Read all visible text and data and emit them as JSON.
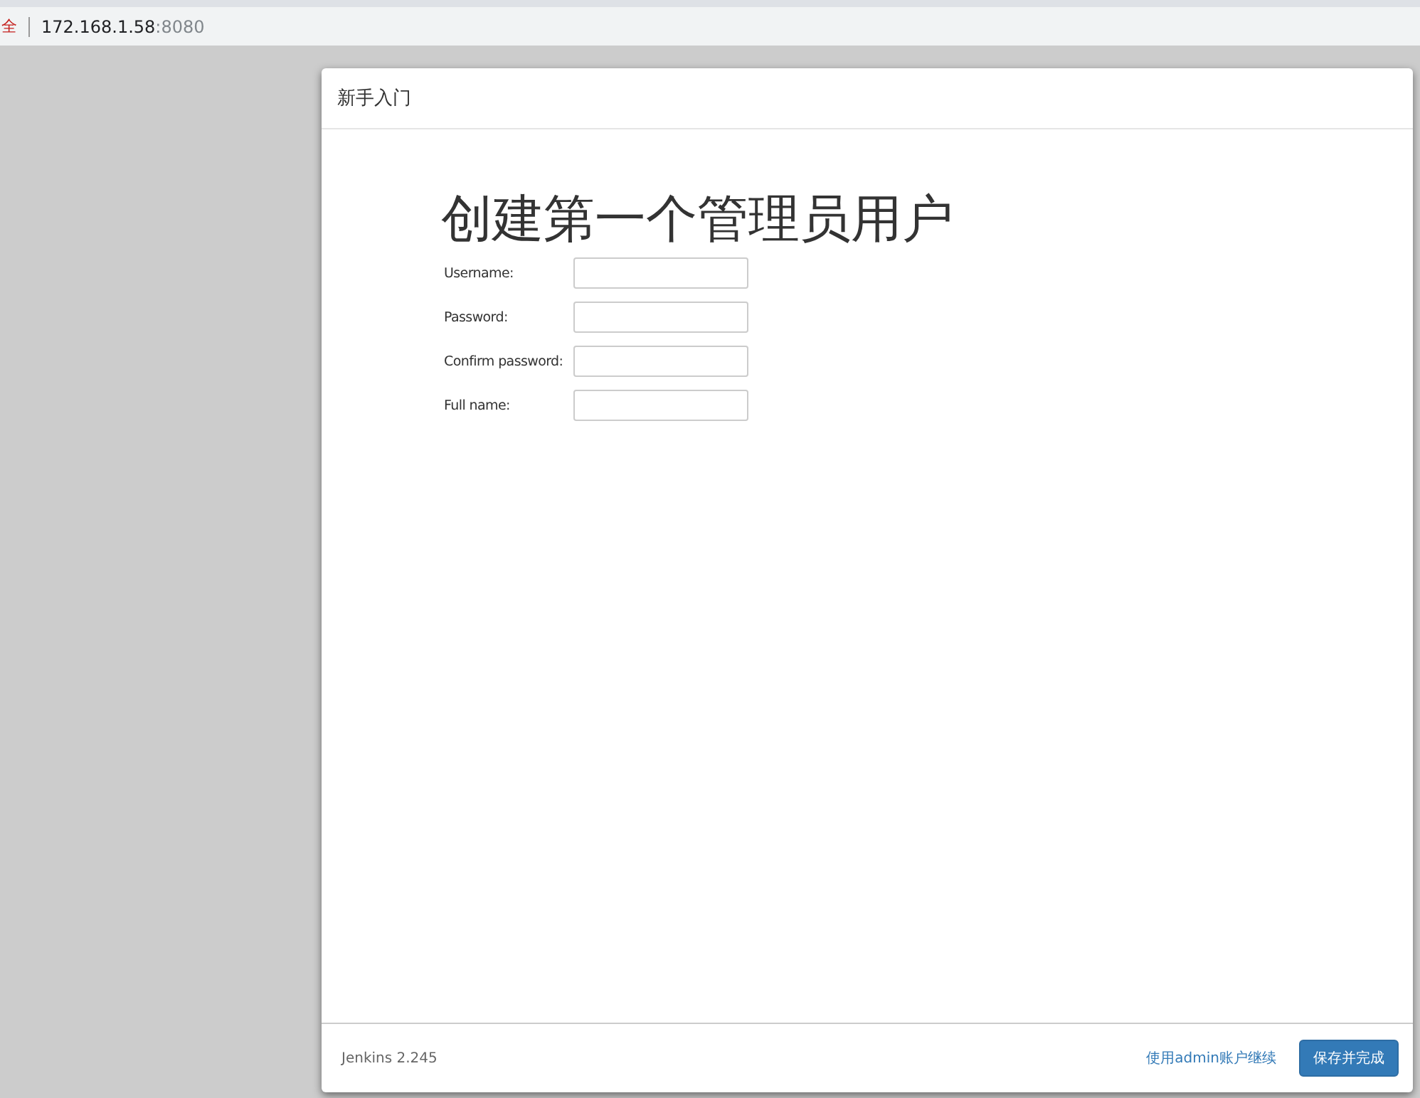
{
  "address_bar": {
    "security_label": "全",
    "host": "172.168.1.58",
    "port": ":8080"
  },
  "dialog": {
    "title": "新手入门",
    "heading": "创建第一个管理员用户",
    "fields": [
      {
        "label": "Username:"
      },
      {
        "label": "Password:"
      },
      {
        "label": "Confirm password:"
      },
      {
        "label": "Full name:"
      }
    ],
    "version": "Jenkins 2.245",
    "continue_link": "使用admin账户继续",
    "save_button": "保存并完成"
  }
}
